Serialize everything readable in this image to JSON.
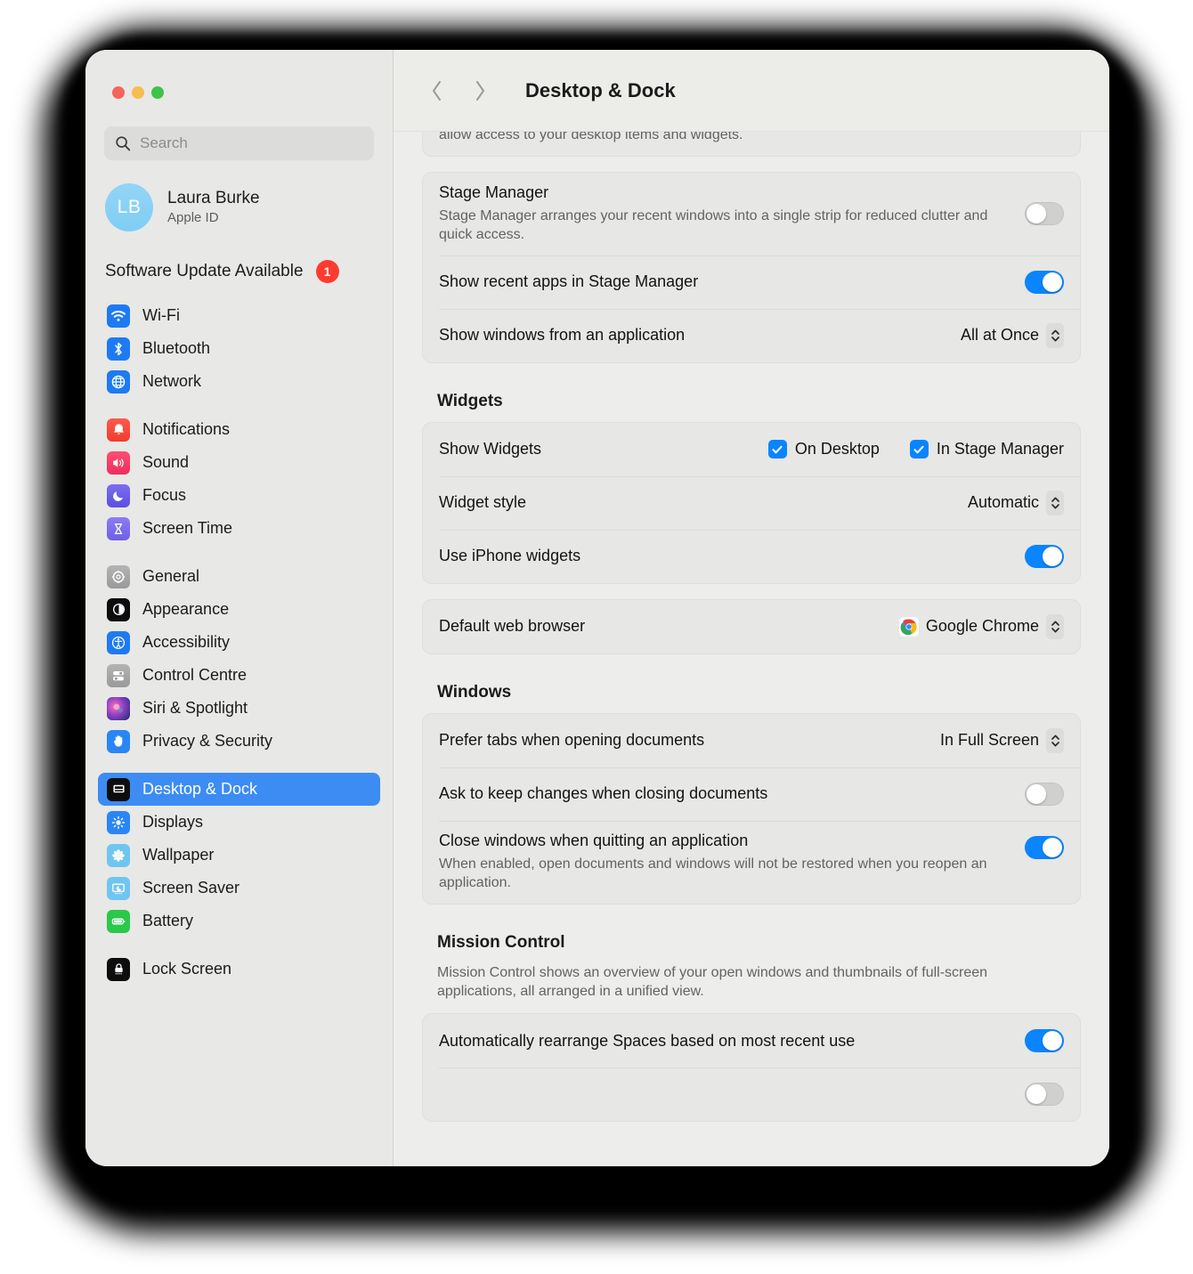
{
  "window": {
    "traffic_lights": [
      "close",
      "minimize",
      "zoom"
    ]
  },
  "sidebar": {
    "search": {
      "placeholder": "Search",
      "value": ""
    },
    "account": {
      "initials": "LB",
      "name": "Laura Burke",
      "subtitle": "Apple ID"
    },
    "update": {
      "label": "Software Update Available",
      "badge": "1"
    },
    "groups": [
      {
        "items": [
          {
            "label": "Wi-Fi",
            "icon": "wifi-icon"
          },
          {
            "label": "Bluetooth",
            "icon": "bluetooth-icon"
          },
          {
            "label": "Network",
            "icon": "network-icon"
          }
        ]
      },
      {
        "items": [
          {
            "label": "Notifications",
            "icon": "bell-icon"
          },
          {
            "label": "Sound",
            "icon": "speaker-icon"
          },
          {
            "label": "Focus",
            "icon": "moon-icon"
          },
          {
            "label": "Screen Time",
            "icon": "hourglass-icon"
          }
        ]
      },
      {
        "items": [
          {
            "label": "General",
            "icon": "gear-icon"
          },
          {
            "label": "Appearance",
            "icon": "appearance-icon"
          },
          {
            "label": "Accessibility",
            "icon": "accessibility-icon"
          },
          {
            "label": "Control Centre",
            "icon": "control-centre-icon"
          },
          {
            "label": "Siri & Spotlight",
            "icon": "siri-icon"
          },
          {
            "label": "Privacy & Security",
            "icon": "hand-icon"
          }
        ]
      },
      {
        "items": [
          {
            "label": "Desktop & Dock",
            "icon": "desktop-dock-icon",
            "selected": true
          },
          {
            "label": "Displays",
            "icon": "display-icon"
          },
          {
            "label": "Wallpaper",
            "icon": "wallpaper-icon"
          },
          {
            "label": "Screen Saver",
            "icon": "screen-saver-icon"
          },
          {
            "label": "Battery",
            "icon": "battery-icon"
          }
        ]
      },
      {
        "items": [
          {
            "label": "Lock Screen",
            "icon": "lock-icon"
          }
        ]
      }
    ]
  },
  "header": {
    "back": "‹",
    "forward": "›",
    "title": "Desktop & Dock"
  },
  "main": {
    "clipped_top_text": "allow access to your desktop items and widgets.",
    "stage_manager": {
      "title": "Stage Manager",
      "desc": "Stage Manager arranges your recent windows into a single strip for reduced clutter and quick access.",
      "toggle": "off",
      "recent_apps_label": "Show recent apps in Stage Manager",
      "recent_apps_toggle": "on",
      "show_windows_label": "Show windows from an application",
      "show_windows_value": "All at Once"
    },
    "widgets": {
      "heading": "Widgets",
      "show_widgets_label": "Show Widgets",
      "on_desktop_label": "On Desktop",
      "on_desktop_checked": true,
      "in_stage_manager_label": "In Stage Manager",
      "in_stage_manager_checked": true,
      "widget_style_label": "Widget style",
      "widget_style_value": "Automatic",
      "iphone_widgets_label": "Use iPhone widgets",
      "iphone_widgets_toggle": "on"
    },
    "browser": {
      "label": "Default web browser",
      "value": "Google Chrome",
      "icon": "chrome-icon"
    },
    "windows": {
      "heading": "Windows",
      "prefer_tabs_label": "Prefer tabs when opening documents",
      "prefer_tabs_value": "In Full Screen",
      "ask_keep_label": "Ask to keep changes when closing documents",
      "ask_keep_toggle": "off",
      "close_windows_label": "Close windows when quitting an application",
      "close_windows_desc": "When enabled, open documents and windows will not be restored when you reopen an application.",
      "close_windows_toggle": "on"
    },
    "mission_control": {
      "heading": "Mission Control",
      "desc": "Mission Control shows an overview of your open windows and thumbnails of full-screen applications, all arranged in a unified view.",
      "rearrange_label": "Automatically rearrange Spaces based on most recent use",
      "rearrange_toggle": "on"
    }
  },
  "colors": {
    "accent_blue": "#0a84ff",
    "selection_blue": "#3c8cf4",
    "badge_red": "#ff3b30",
    "window_bg": "#ececec",
    "sidebar_bg": "#e8e8e6",
    "card_bg": "#e7e7e5"
  }
}
